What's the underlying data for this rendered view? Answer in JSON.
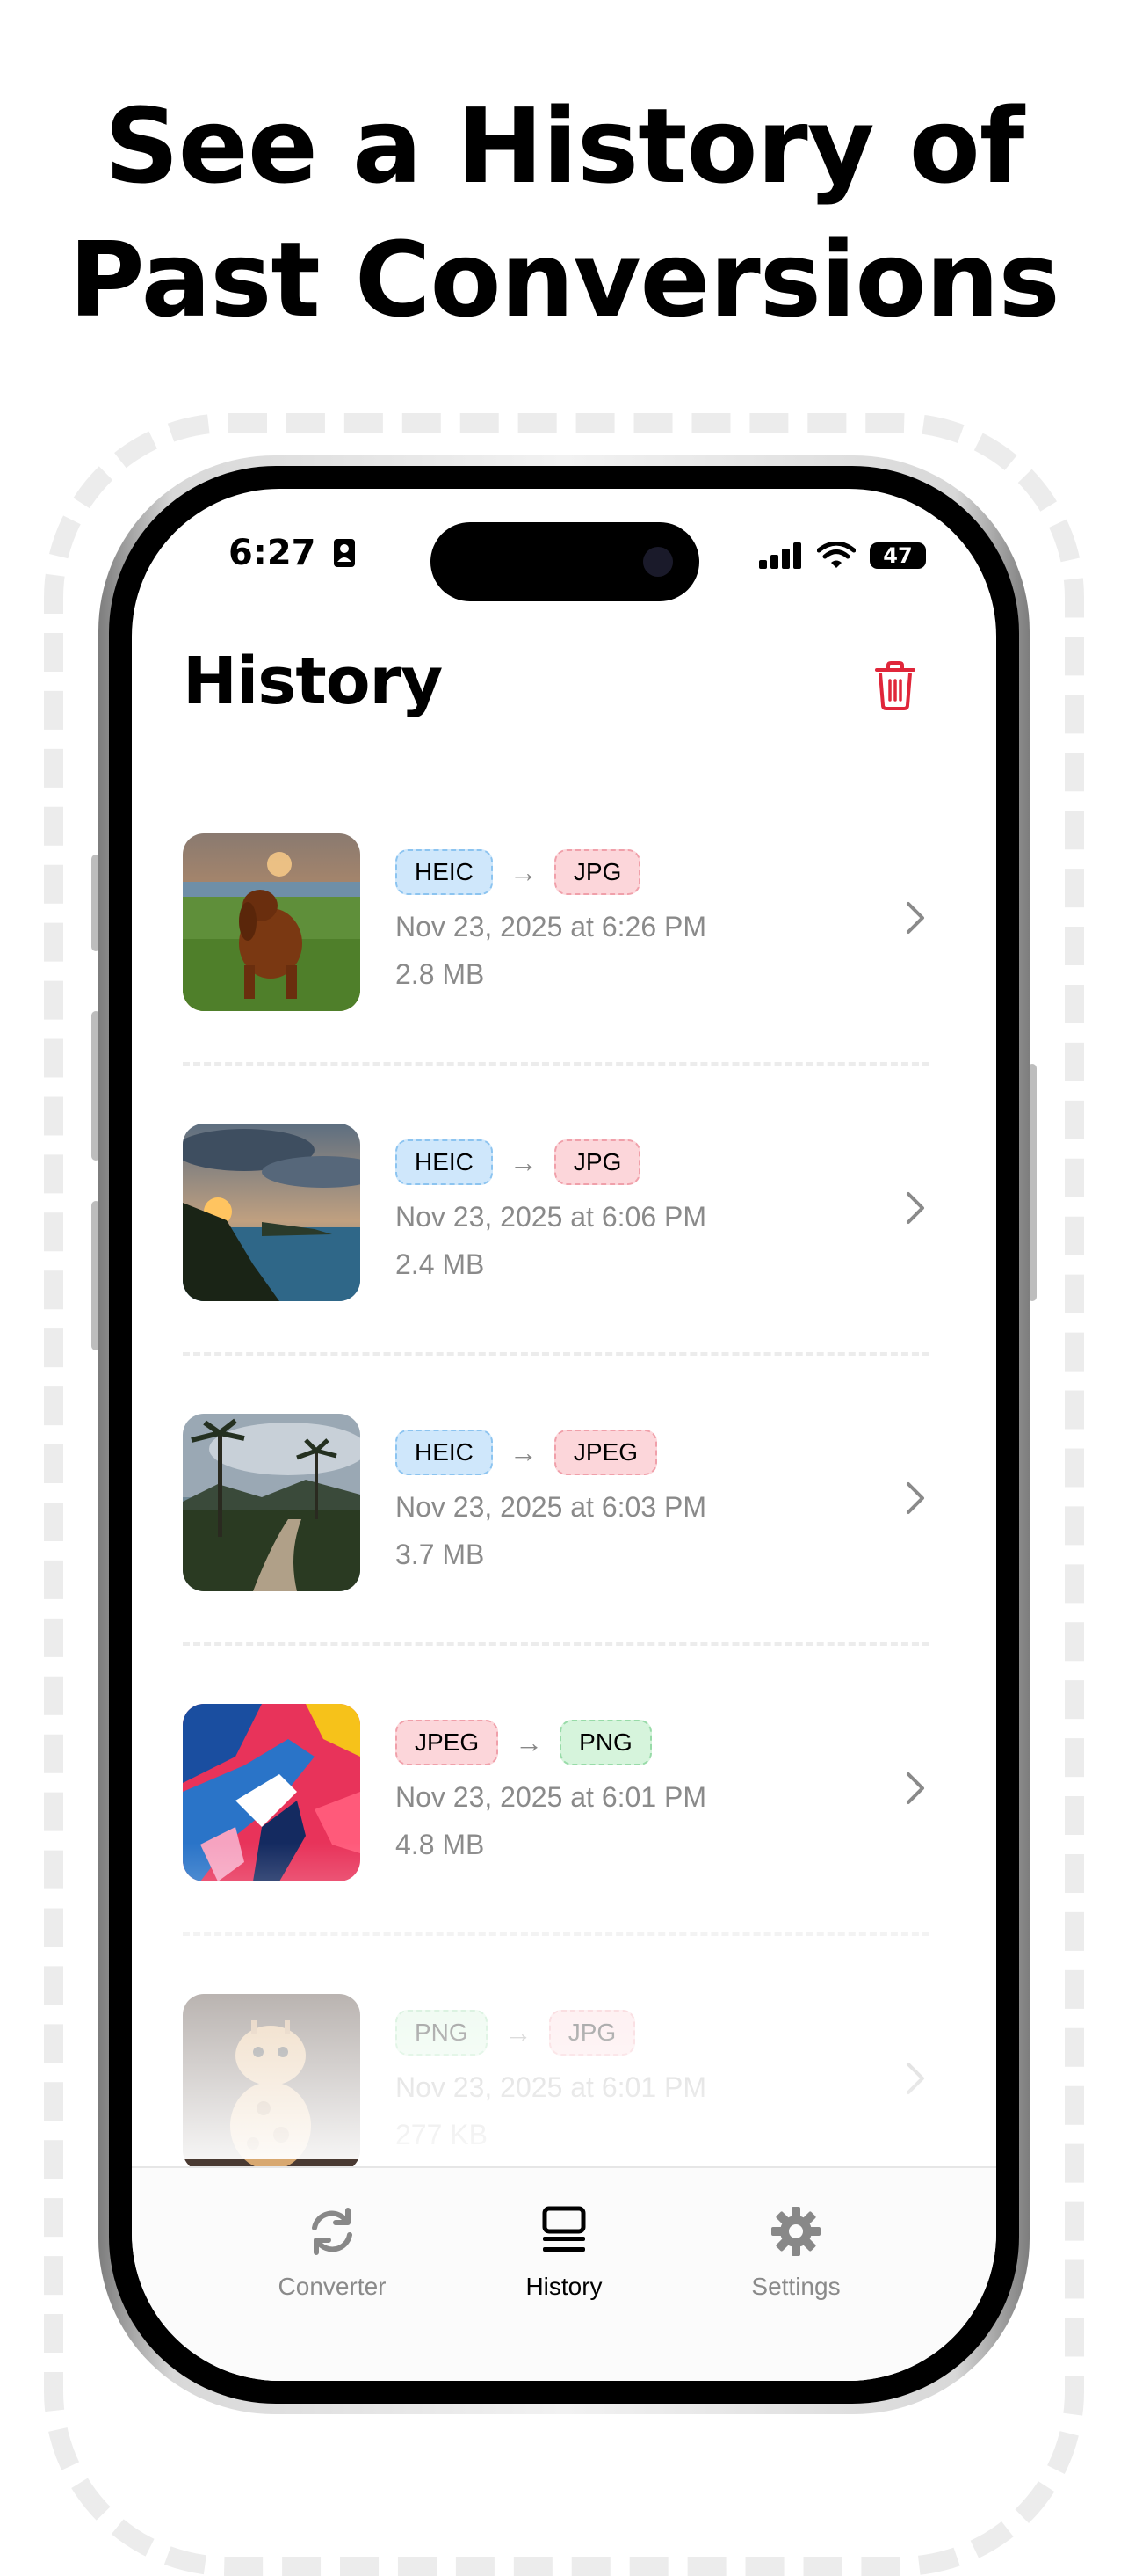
{
  "headline": {
    "line1": "See a History of",
    "line2": "Past Conversions"
  },
  "status_bar": {
    "time": "6:27",
    "battery": "47"
  },
  "page": {
    "title": "History"
  },
  "items": [
    {
      "from": "HEIC",
      "to": "JPG",
      "date": "Nov 23, 2025 at 6:26 PM",
      "size": "2.8 MB",
      "thumb": "dog-photo"
    },
    {
      "from": "HEIC",
      "to": "JPG",
      "date": "Nov 23, 2025 at 6:06 PM",
      "size": "2.4 MB",
      "thumb": "coastline-photo"
    },
    {
      "from": "HEIC",
      "to": "JPEG",
      "date": "Nov 23, 2025 at 6:03 PM",
      "size": "3.7 MB",
      "thumb": "palm-path-photo"
    },
    {
      "from": "JPEG",
      "to": "PNG",
      "date": "Nov 23, 2025 at 6:01 PM",
      "size": "4.8 MB",
      "thumb": "abstract-art-photo"
    },
    {
      "from": "PNG",
      "to": "JPG",
      "date": "Nov 23, 2025 at 6:01 PM",
      "size": "277 KB",
      "thumb": "giraffe-toy-photo"
    }
  ],
  "tabs": [
    {
      "label": "Converter",
      "icon": "refresh-icon",
      "active": false
    },
    {
      "label": "History",
      "icon": "list-icon",
      "active": true
    },
    {
      "label": "Settings",
      "icon": "gear-icon",
      "active": false
    }
  ],
  "colors": {
    "heic": "#cfe7fb",
    "jpg": "#fcd6da",
    "png": "#d6f4dc",
    "trash": "#e0263a",
    "accent_text": "#000000"
  }
}
